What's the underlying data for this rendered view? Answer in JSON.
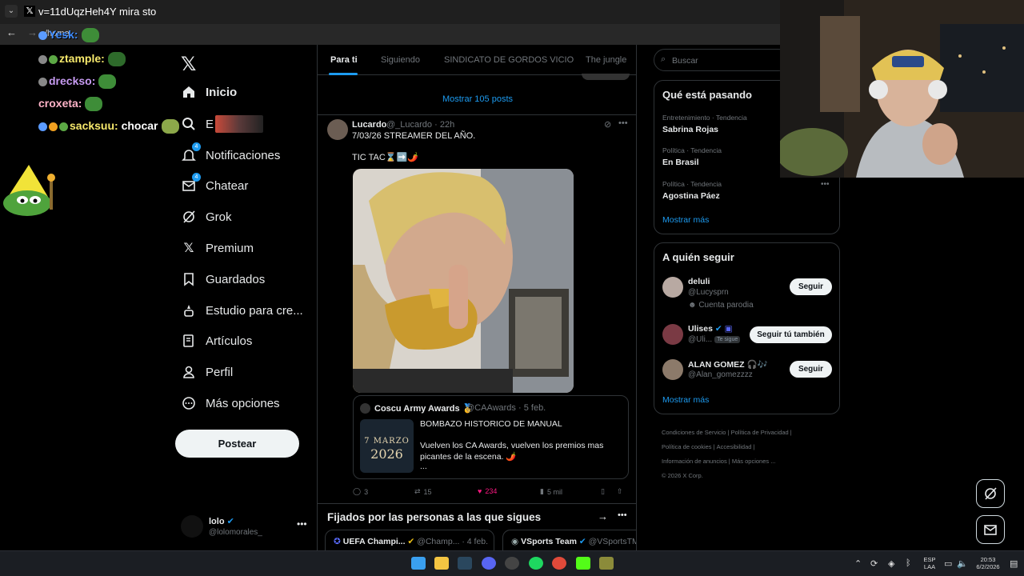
{
  "browser": {
    "tab_title": "v=11dUqzHeh4Y mira sto",
    "url": "/home"
  },
  "chat": [
    {
      "user": "Yesk:",
      "color": "#3f8cff",
      "text": ""
    },
    {
      "user": "ztample:",
      "color": "#f7e96c",
      "text": ""
    },
    {
      "user": "drecksо:",
      "color": "#c79bf2",
      "text": ""
    },
    {
      "user": "croxeta:",
      "color": "#ffb3c8",
      "text": ""
    },
    {
      "user": "sacksuu:",
      "color": "#f7e96c",
      "text": "chocar"
    }
  ],
  "nav": {
    "items": [
      {
        "label": "Inicio",
        "icon": "home-icon",
        "bold": true
      },
      {
        "label": "E",
        "icon": "search-icon"
      },
      {
        "label": "Notificaciones",
        "icon": "bell-icon",
        "badge": "4"
      },
      {
        "label": "Chatear",
        "icon": "mail-icon",
        "badge": "4"
      },
      {
        "label": "Grok",
        "icon": "grok-icon"
      },
      {
        "label": "Premium",
        "icon": "x-icon"
      },
      {
        "label": "Guardados",
        "icon": "bookmark-icon"
      },
      {
        "label": "Estudio para cre...",
        "icon": "studio-icon"
      },
      {
        "label": "Artículos",
        "icon": "articles-icon"
      },
      {
        "label": "Perfil",
        "icon": "person-icon"
      },
      {
        "label": "Más opciones",
        "icon": "more-circle-icon"
      }
    ],
    "post_button": "Postear",
    "profile": {
      "name": "lolo",
      "handle": "@lolomorales_"
    }
  },
  "feed": {
    "tabs": [
      "Para ti",
      "Siguiendo",
      "SINDICATO DE GORDOS VICIO",
      "The jungle"
    ],
    "show_posts": "Mostrar 105 posts",
    "tweet": {
      "name": "Lucardo",
      "handle": "@_Lucardo",
      "time": "22h",
      "text_line1": "7/03/26 STREAMER DEL AÑO.",
      "text_line2": "TIC TAC⌛➡️🌶️",
      "quote": {
        "name": "Coscu Army Awards 🥇",
        "handle": "@CAAwards",
        "time": "5 feb.",
        "line1": "BOMBAZO HISTORICO DE MANUAL",
        "line2": "Vuelven los CA Awards, vuelven los premios mas",
        "line3": "picantes de la escena. 🌶️",
        "line4": "...",
        "image_date": "7 MARZO",
        "image_year": "2026"
      },
      "replies": "3",
      "reposts": "15",
      "likes": "234",
      "views": "5 mil"
    },
    "pinned_title": "Fijados por las personas a las que sigues",
    "pinned_cards": [
      {
        "name": "UEFA Champi...",
        "handle": "@Champ...",
        "time": "4 feb."
      },
      {
        "name": "VSports Team",
        "handle": "@VSportsTM",
        "time": ""
      }
    ]
  },
  "sidebar": {
    "search_placeholder": "Buscar",
    "trends_title": "Qué está pasando",
    "trends": [
      {
        "meta": "Entretenimiento · Tendencia",
        "name": "Sabrina Rojas"
      },
      {
        "meta": "Política · Tendencia",
        "name": "En Brasil"
      },
      {
        "meta": "Política · Tendencia",
        "name": "Agostina Páez"
      }
    ],
    "trends_more": "Mostrar más",
    "who_title": "A quién seguir",
    "who": [
      {
        "name": "deluli",
        "handle": "@Lucysprn",
        "sub": "Cuenta parodia",
        "button": "Seguir"
      },
      {
        "name": "Ulises",
        "handle": "@Uli...",
        "sub": "Te sigue",
        "button": "Seguir tú también"
      },
      {
        "name": "ALAN GOMEZ 🎧🎶",
        "handle": "@Alan_gomezzzz",
        "sub": "",
        "button": "Seguir"
      }
    ],
    "who_more": "Mostrar más",
    "footer": [
      "Condiciones de Servicio",
      "Política de Privacidad",
      "Política de cookies",
      "Accesibilidad",
      "Información de anuncios",
      "Más opciones ...",
      "© 2026 X Corp."
    ]
  },
  "taskbar": {
    "lang": "ESP",
    "lang2": "LAA",
    "time": "20:53",
    "date": "6/2/2026"
  }
}
